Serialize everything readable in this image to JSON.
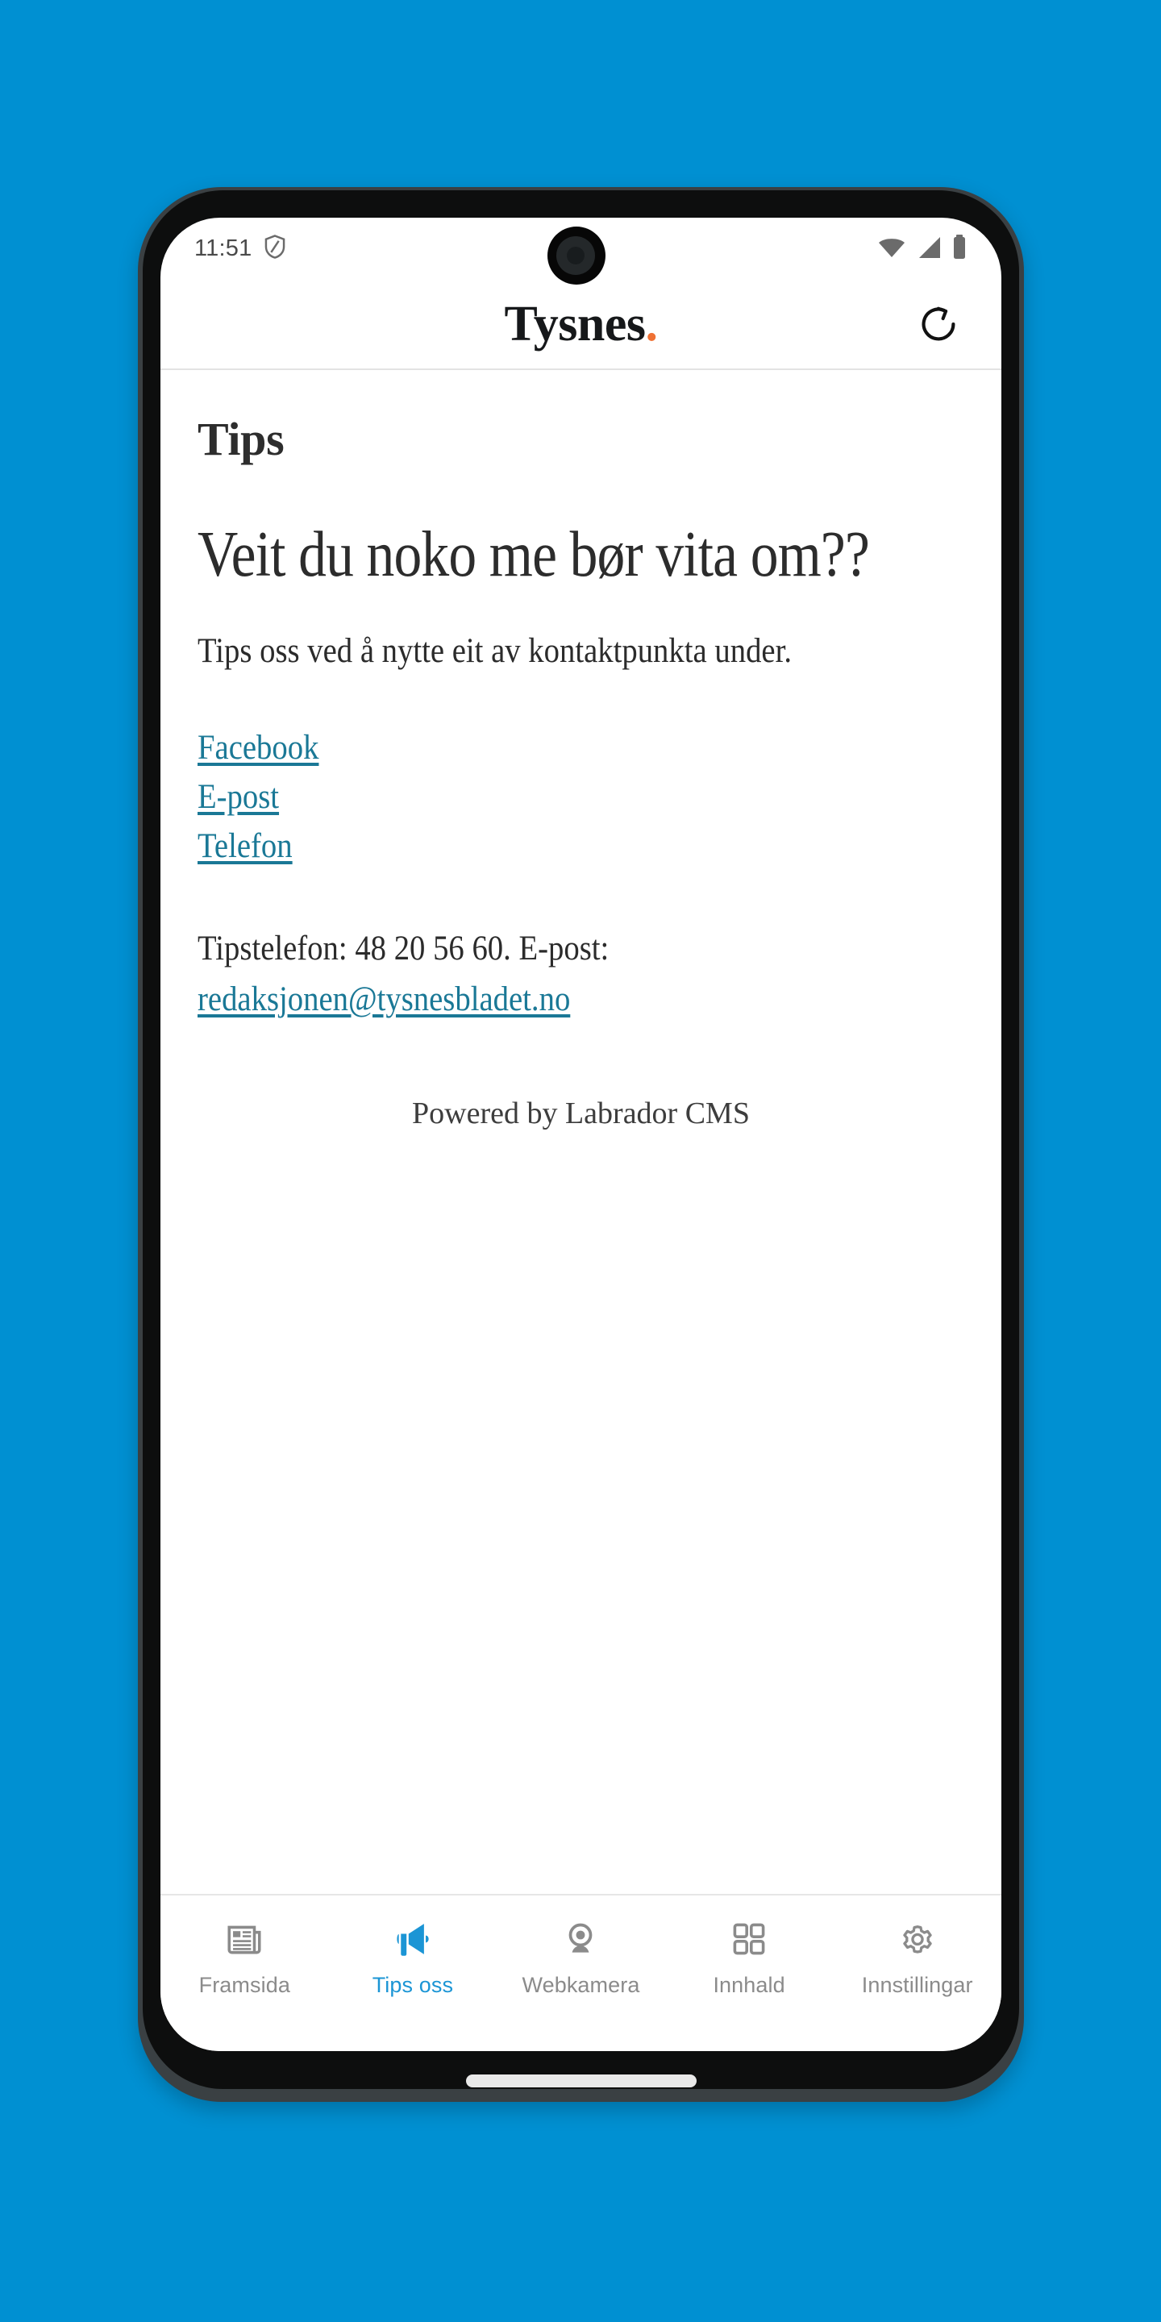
{
  "theme": {
    "background": "#0090d2",
    "brand_dot": "#ef7134",
    "link": "#1a7896",
    "active_nav": "#1b95d5",
    "nav_inactive": "#8b8b8b"
  },
  "status_bar": {
    "time": "11:51",
    "icons": [
      "shield-icon",
      "wifi-icon",
      "cellular-signal-icon",
      "battery-icon"
    ]
  },
  "header": {
    "brand": "Tysnes",
    "brand_dot": ".",
    "refresh_icon": "refresh-icon"
  },
  "content": {
    "kicker": "Tips",
    "headline": "Veit du noko me bør vita om??",
    "lead": "Tips oss ved å nytte eit av kontaktpunkta under.",
    "links": [
      {
        "label": "Facebook"
      },
      {
        "label": "E-post"
      },
      {
        "label": "Telefon"
      }
    ],
    "contact_prefix": "Tipstelefon: 48 20 56 60. E-post:",
    "contact_email": "redaksjonen@tysnesbladet.no",
    "powered_by": "Powered by Labrador CMS"
  },
  "bottom_nav": {
    "items": [
      {
        "label": "Framsida",
        "icon": "newspaper-icon",
        "active": false
      },
      {
        "label": "Tips oss",
        "icon": "megaphone-icon",
        "active": true
      },
      {
        "label": "Webkamera",
        "icon": "webcam-icon",
        "active": false
      },
      {
        "label": "Innhald",
        "icon": "grid-icon",
        "active": false
      },
      {
        "label": "Innstillingar",
        "icon": "gear-icon",
        "active": false
      }
    ]
  }
}
